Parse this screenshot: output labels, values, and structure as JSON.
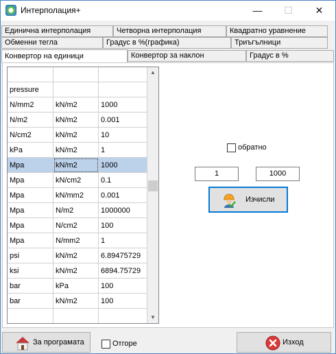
{
  "window": {
    "title": "Интерполация+",
    "min_glyph": "—",
    "max_glyph": "☐",
    "close_glyph": "✕"
  },
  "tabs": {
    "row1": [
      "Единична интерполация",
      "Четворна интерполация",
      "Квадратно уравнение"
    ],
    "row2": [
      "Обменни тегла",
      "Градус в %(графика)",
      "Триъгълници"
    ],
    "row3": [
      "Конвертор на единици",
      "Конвертор за наклон",
      "Градус в %"
    ],
    "active": "Конвертор на единици"
  },
  "grid": {
    "rows": [
      [
        "",
        "",
        ""
      ],
      [
        "pressure",
        "",
        ""
      ],
      [
        "N/mm2",
        "kN/m2",
        "1000"
      ],
      [
        "N/m2",
        "kN/m2",
        "0.001"
      ],
      [
        "N/cm2",
        "kN/m2",
        "10"
      ],
      [
        "kPa",
        "kN/m2",
        "1"
      ],
      [
        "Mpa",
        "kN/m2",
        "1000"
      ],
      [
        "Mpa",
        "kN/cm2",
        "0.1"
      ],
      [
        "Mpa",
        "kN/mm2",
        "0.001"
      ],
      [
        "Mpa",
        "N/m2",
        "1000000"
      ],
      [
        "Mpa",
        "N/cm2",
        "100"
      ],
      [
        "Mpa",
        "N/mm2",
        "1"
      ],
      [
        "psi",
        "kN/m2",
        "6.89475729"
      ],
      [
        "ksi",
        "kN/m2",
        "6894.75729"
      ],
      [
        "bar",
        "kPa",
        "100"
      ],
      [
        "bar",
        "kN/m2",
        "100"
      ],
      [
        "",
        "",
        ""
      ]
    ],
    "selected_row": 6,
    "scroll_up_glyph": "▲",
    "scroll_down_glyph": "▼"
  },
  "converter": {
    "reverse_label": "обратно",
    "reverse_checked": false,
    "input_value": "1",
    "result_value": "1000",
    "calculate_label": "Изчисли"
  },
  "footer": {
    "about_label": "За програмата",
    "on_top_label": "Отгоре",
    "on_top_checked": false,
    "exit_label": "Изход"
  },
  "colors": {
    "selection": "#bcd1ea",
    "focus_border": "#0078d7",
    "window_border": "#4a86c5",
    "exit_icon": "#d83a3a",
    "check_mark": "#3aa935",
    "helmet": "#f5a623"
  }
}
